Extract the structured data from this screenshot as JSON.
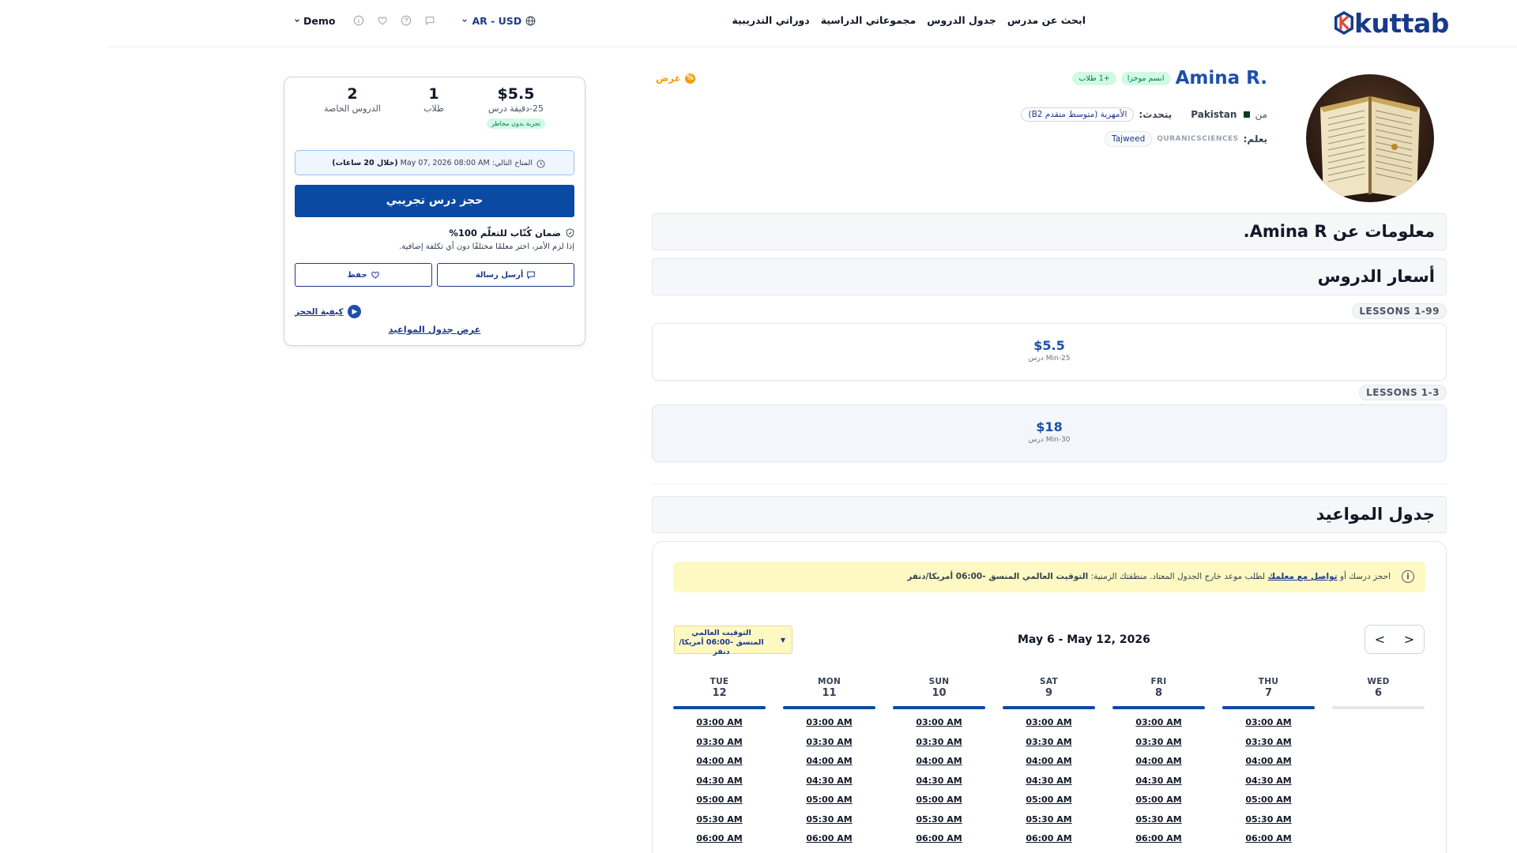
{
  "header": {
    "logo_text": "kuttab",
    "nav": [
      "ابحث عن مدرس",
      "جدول الدروس",
      "مجموعاتي الدراسية",
      "دوراتي التدريبية"
    ],
    "user_label": "Demo",
    "lang_currency": "AR - USD"
  },
  "profile": {
    "name": "Amina R.",
    "badge_new": "انسم موخزا",
    "badge_students": "+1 طلاب",
    "offer_label": "عرض",
    "from_label": "من",
    "country": "Pakistan",
    "speaks_label": "يتحدث:",
    "language_chip": "الأمهرية (متوسط متقدم B2)",
    "teaches_label": "يعلم:",
    "teaches_category": "QURANICSCIENCES",
    "teaches_subject": "Tajweed"
  },
  "sections": {
    "about_title": "معلومات عن Amina R.",
    "prices_title": "أسعار الدروس",
    "schedule_title": "جدول المواعيد"
  },
  "prices": [
    {
      "tag": "LESSONS 1-99",
      "amount": "$5.5",
      "duration": "Min-25 درس"
    },
    {
      "tag": "LESSONS 1-3",
      "amount": "$18",
      "duration": "Min-30 درس"
    }
  ],
  "schedule": {
    "notice_prefix": "احجز درسك أو",
    "notice_link": "تواصل مع معلمك",
    "notice_middle": "لطلب موعد خارج الجدول المعتاد. منطقتك الزمنية:",
    "notice_tz": "التوقيت العالمي المنسق -06:00 أمريكا/دنفر",
    "tz_select": "التوقيت العالمي المنسق -06:00 أمريكا/دنفر",
    "range": "May 6 - May 12, 2026",
    "prev": "<",
    "next": ">",
    "days": [
      {
        "name": "WED",
        "date": "6",
        "active": false,
        "slots": []
      },
      {
        "name": "THU",
        "date": "7",
        "active": true,
        "slots": [
          "03:00 AM",
          "03:30 AM",
          "04:00 AM",
          "04:30 AM",
          "05:00 AM",
          "05:30 AM",
          "06:00 AM"
        ]
      },
      {
        "name": "FRI",
        "date": "8",
        "active": true,
        "slots": [
          "03:00 AM",
          "03:30 AM",
          "04:00 AM",
          "04:30 AM",
          "05:00 AM",
          "05:30 AM",
          "06:00 AM"
        ]
      },
      {
        "name": "SAT",
        "date": "9",
        "active": true,
        "slots": [
          "03:00 AM",
          "03:30 AM",
          "04:00 AM",
          "04:30 AM",
          "05:00 AM",
          "05:30 AM",
          "06:00 AM"
        ]
      },
      {
        "name": "SUN",
        "date": "10",
        "active": true,
        "slots": [
          "03:00 AM",
          "03:30 AM",
          "04:00 AM",
          "04:30 AM",
          "05:00 AM",
          "05:30 AM",
          "06:00 AM"
        ]
      },
      {
        "name": "MON",
        "date": "11",
        "active": true,
        "slots": [
          "03:00 AM",
          "03:30 AM",
          "04:00 AM",
          "04:30 AM",
          "05:00 AM",
          "05:30 AM",
          "06:00 AM"
        ]
      },
      {
        "name": "TUE",
        "date": "12",
        "active": true,
        "slots": [
          "03:00 AM",
          "03:30 AM",
          "04:00 AM",
          "04:30 AM",
          "05:00 AM",
          "05:30 AM",
          "06:00 AM"
        ]
      }
    ]
  },
  "booking": {
    "price": "$5.5",
    "price_label": "25-دقيقة درس",
    "price_badge": "تجربة بدون مخاطر",
    "students": "1",
    "students_label": "طلاب",
    "lessons": "2",
    "lessons_label": "الدروس الخاصة",
    "next_available_label": "المتاح التالي:",
    "next_available_time": "May 07, 2026 08:00 AM",
    "next_available_in": "(خلال 20 ساعات)",
    "cta": "حجز درس تجريبي",
    "guarantee_title": "ضمان كُتّاب للتعلّم 100%",
    "guarantee_sub": "إذا لزم الأمر، اختر معلمًا مختلفًا دون أي تكلفة إضافية.",
    "message_btn": "أرسل رسالة",
    "save_btn": "حفظ",
    "how_label": "كيفية الحجز",
    "view_schedule": "عرض جدول المواعيد"
  },
  "colors": {
    "brand": "#0b4aa2",
    "name": "#1e4fa8",
    "notice_bg": "#fef9c3",
    "offer": "#f59e0b"
  }
}
